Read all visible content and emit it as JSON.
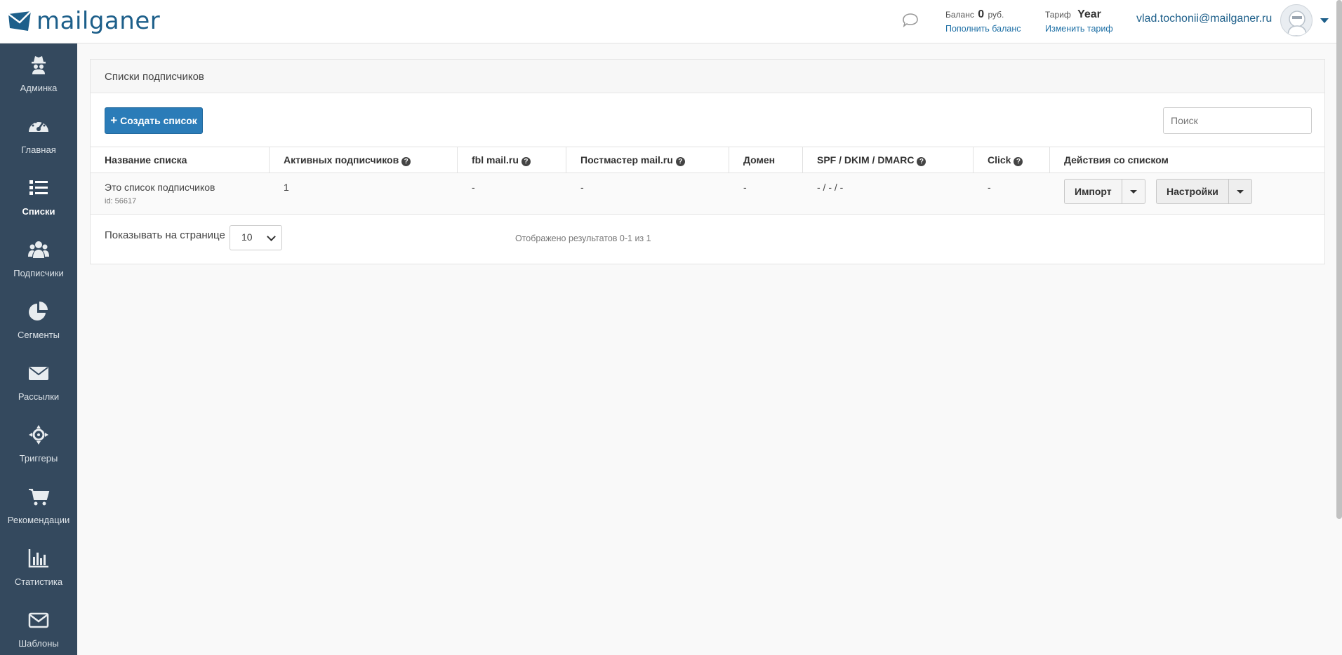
{
  "app": {
    "logo_text": "mailganer"
  },
  "header": {
    "balance_label": "Баланс",
    "balance_value": "0",
    "balance_currency": "руб.",
    "balance_link": "Пополнить баланс",
    "tariff_label": "Тариф",
    "tariff_value": "Year",
    "tariff_link": "Изменить тариф",
    "user_email": "vlad.tochonii@mailganer.ru"
  },
  "sidebar": {
    "items": [
      {
        "label": "Админка",
        "icon": "spy-icon"
      },
      {
        "label": "Главная",
        "icon": "dashboard-icon"
      },
      {
        "label": "Списки",
        "icon": "list-icon",
        "active": true
      },
      {
        "label": "Подписчики",
        "icon": "users-icon"
      },
      {
        "label": "Сегменты",
        "icon": "pie-chart-icon"
      },
      {
        "label": "Рассылки",
        "icon": "envelope-icon"
      },
      {
        "label": "Триггеры",
        "icon": "crosshair-icon"
      },
      {
        "label": "Рекомендации",
        "icon": "cart-icon"
      },
      {
        "label": "Статистика",
        "icon": "bar-chart-icon"
      },
      {
        "label": "Шаблоны",
        "icon": "envelope-outline-icon"
      }
    ]
  },
  "main": {
    "panel_title": "Списки подписчиков",
    "create_button": "Создать список",
    "search_placeholder": "Поиск",
    "columns": [
      "Название списка",
      "Активных подписчиков",
      "fbl mail.ru",
      "Постмастер mail.ru",
      "Домен",
      "SPF / DKIM / DMARC",
      "Click",
      "Действия со списком"
    ],
    "rows": [
      {
        "name": "Это список подписчиков",
        "id": "id: 56617",
        "active": "1",
        "fbl": "-",
        "postmaster": "-",
        "domain": "-",
        "spf": "- / - / -",
        "click": "-",
        "import_label": "Импорт",
        "settings_label": "Настройки"
      }
    ],
    "per_page_label": "Показывать на странице",
    "per_page_value": "10",
    "results_text": "Отображено результатов 0-1 из 1"
  },
  "colors": {
    "sidebar": "#34495e",
    "primary": "#2b7cb8",
    "brand": "#1d5f8a"
  }
}
